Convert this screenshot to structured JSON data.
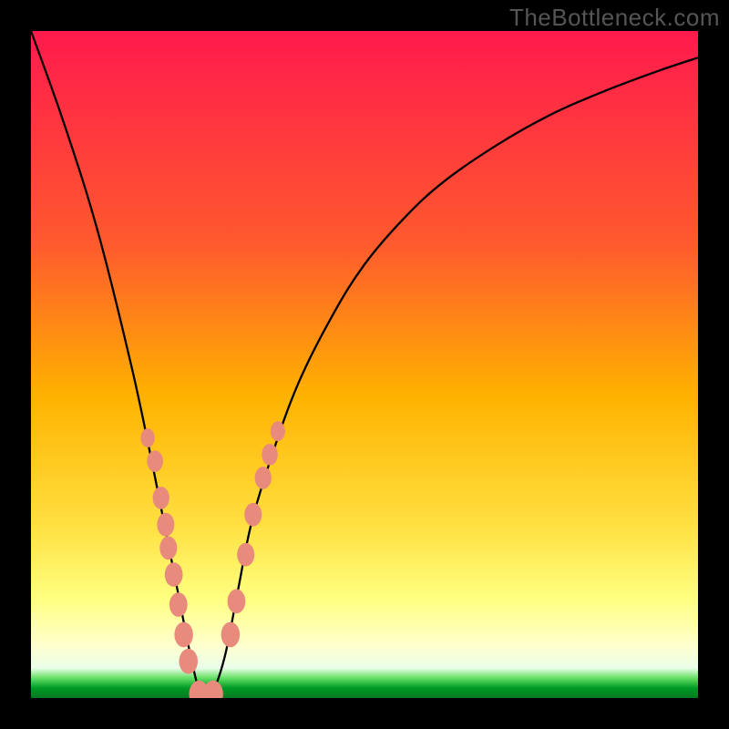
{
  "watermark": "TheBottleneck.com",
  "chart_data": {
    "type": "line",
    "title": "",
    "xlabel": "",
    "ylabel": "",
    "xlim": [
      0,
      100
    ],
    "ylim": [
      0,
      100
    ],
    "gradient_stops": [
      {
        "offset": 0,
        "color": "#ff1a4d"
      },
      {
        "offset": 0.32,
        "color": "#ff5a2d"
      },
      {
        "offset": 0.55,
        "color": "#ffb300"
      },
      {
        "offset": 0.74,
        "color": "#ffe040"
      },
      {
        "offset": 0.85,
        "color": "#ffff80"
      },
      {
        "offset": 0.92,
        "color": "#ffffcc"
      },
      {
        "offset": 0.955,
        "color": "#eaffea"
      },
      {
        "offset": 0.97,
        "color": "#66e066"
      },
      {
        "offset": 0.985,
        "color": "#009926"
      },
      {
        "offset": 1.0,
        "color": "#007a1f"
      }
    ],
    "series": [
      {
        "name": "bottleneck-curve",
        "x": [
          0,
          5,
          10,
          15,
          18,
          20,
          22,
          24,
          25.5,
          27,
          29,
          31,
          33,
          36,
          40,
          45,
          50,
          56,
          62,
          70,
          78,
          86,
          94,
          100
        ],
        "y": [
          100,
          86,
          70,
          50,
          36,
          26,
          16,
          6,
          0.5,
          0.5,
          6,
          16,
          26,
          36,
          47,
          57,
          65,
          72,
          77.5,
          83,
          87.5,
          91,
          94,
          96
        ]
      }
    ],
    "minimum_x": 26.2,
    "markers": [
      {
        "x": 17.5,
        "y": 39.0,
        "r": 1.05
      },
      {
        "x": 18.6,
        "y": 35.5,
        "r": 1.2
      },
      {
        "x": 19.5,
        "y": 30.0,
        "r": 1.25
      },
      {
        "x": 20.2,
        "y": 26.0,
        "r": 1.3
      },
      {
        "x": 20.6,
        "y": 22.5,
        "r": 1.3
      },
      {
        "x": 21.4,
        "y": 18.5,
        "r": 1.35
      },
      {
        "x": 22.1,
        "y": 14.0,
        "r": 1.35
      },
      {
        "x": 22.9,
        "y": 9.5,
        "r": 1.4
      },
      {
        "x": 23.6,
        "y": 5.5,
        "r": 1.4
      },
      {
        "x": 25.2,
        "y": 0.6,
        "r": 1.5
      },
      {
        "x": 27.3,
        "y": 0.6,
        "r": 1.5
      },
      {
        "x": 29.9,
        "y": 9.5,
        "r": 1.4
      },
      {
        "x": 30.8,
        "y": 14.5,
        "r": 1.35
      },
      {
        "x": 32.2,
        "y": 21.5,
        "r": 1.3
      },
      {
        "x": 33.3,
        "y": 27.5,
        "r": 1.3
      },
      {
        "x": 34.8,
        "y": 33.0,
        "r": 1.25
      },
      {
        "x": 35.8,
        "y": 36.5,
        "r": 1.2
      },
      {
        "x": 37.0,
        "y": 40.0,
        "r": 1.1
      }
    ],
    "marker_fill": "#e98b7c",
    "curve_stroke": "#000000",
    "curve_width": 2.3,
    "background": "#000000"
  }
}
